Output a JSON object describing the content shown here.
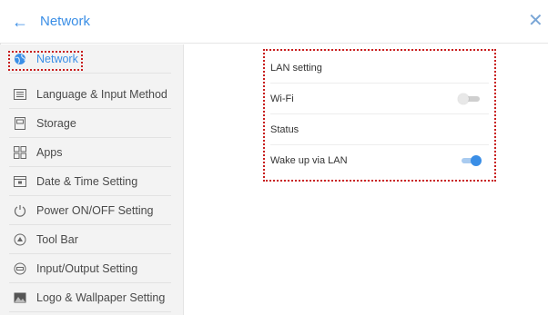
{
  "header": {
    "back_icon": "arrow-left-icon",
    "back_glyph": "←",
    "title": "Network",
    "close_icon": "close-icon",
    "close_glyph": "✕"
  },
  "sidebar": {
    "items": [
      {
        "label": "Network",
        "icon": "globe-icon",
        "active": true
      },
      {
        "label": "Language & Input Method",
        "icon": "keyboard-icon"
      },
      {
        "label": "Storage",
        "icon": "storage-icon"
      },
      {
        "label": "Apps",
        "icon": "apps-grid-icon"
      },
      {
        "label": "Date & Time Setting",
        "icon": "calendar-icon"
      },
      {
        "label": "Power ON/OFF Setting",
        "icon": "power-icon"
      },
      {
        "label": "Tool Bar",
        "icon": "toolbar-icon"
      },
      {
        "label": "Input/Output Setting",
        "icon": "input-output-icon"
      },
      {
        "label": "Logo & Wallpaper Setting",
        "icon": "image-icon"
      }
    ]
  },
  "settings": {
    "rows": [
      {
        "label": "LAN setting"
      },
      {
        "label": "Wi-Fi",
        "toggle": "off"
      },
      {
        "label": "Status"
      },
      {
        "label": "Wake up via LAN",
        "toggle": "on"
      }
    ]
  },
  "colors": {
    "accent": "#3a8ee6",
    "highlight": "#c81e1e",
    "sidebar_bg": "#f3f3f3"
  }
}
